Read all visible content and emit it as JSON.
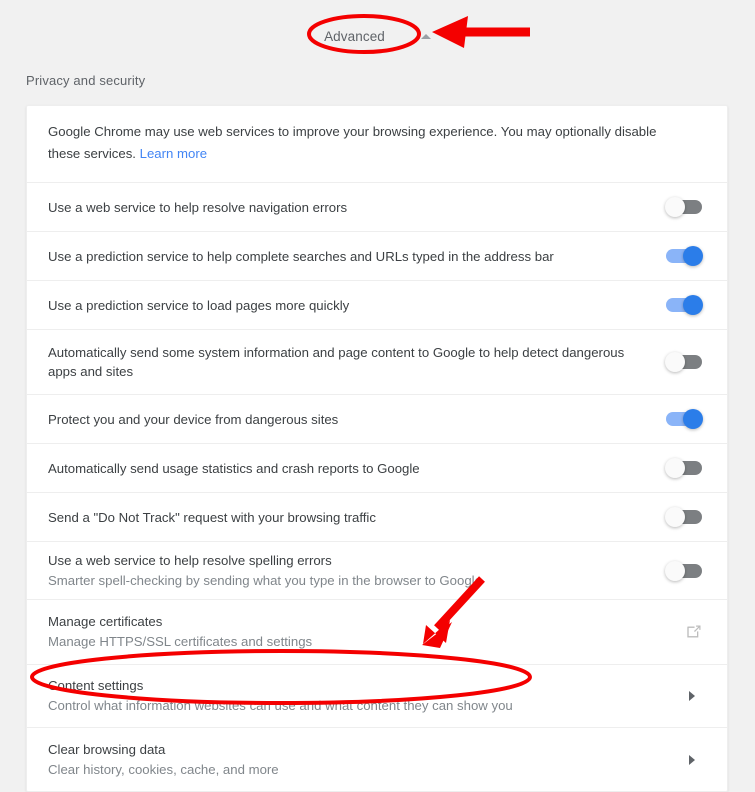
{
  "header": {
    "advanced_label": "Advanced",
    "caret_icon": "caret-up-icon"
  },
  "section": {
    "title": "Privacy and security"
  },
  "colors": {
    "page_background": "#f1f1f1",
    "card_background": "#ffffff",
    "primary_text": "#3c4043",
    "secondary_text": "#80868b",
    "link": "#4285f4",
    "toggle_on_knob": "#2b7de9",
    "toggle_on_track": "#8ab4f8",
    "toggle_off_track": "#7c7f82",
    "annotation_red": "#f40000"
  },
  "intro": {
    "text_before_link": "Google Chrome may use web services to improve your browsing experience. You may optionally disable these services. ",
    "link_label": "Learn more"
  },
  "rows": [
    {
      "label": "Use a web service to help resolve navigation errors",
      "sub": "",
      "control": "toggle",
      "state": "off"
    },
    {
      "label": "Use a prediction service to help complete searches and URLs typed in the address bar",
      "sub": "",
      "control": "toggle",
      "state": "on"
    },
    {
      "label": "Use a prediction service to load pages more quickly",
      "sub": "",
      "control": "toggle",
      "state": "on"
    },
    {
      "label": "Automatically send some system information and page content to Google to help detect dangerous apps and sites",
      "sub": "",
      "control": "toggle",
      "state": "off"
    },
    {
      "label": "Protect you and your device from dangerous sites",
      "sub": "",
      "control": "toggle",
      "state": "on"
    },
    {
      "label": "Automatically send usage statistics and crash reports to Google",
      "sub": "",
      "control": "toggle",
      "state": "off"
    },
    {
      "label": "Send a \"Do Not Track\" request with your browsing traffic",
      "sub": "",
      "control": "toggle",
      "state": "off"
    },
    {
      "label": "Use a web service to help resolve spelling errors",
      "sub": "Smarter spell-checking by sending what you type in the browser to Google",
      "control": "toggle",
      "state": "off"
    },
    {
      "label": "Manage certificates",
      "sub": "Manage HTTPS/SSL certificates and settings",
      "control": "external-link",
      "state": ""
    },
    {
      "label": "Content settings",
      "sub": "Control what information websites can use and what content they can show you",
      "control": "chevron",
      "state": ""
    },
    {
      "label": "Clear browsing data",
      "sub": "Clear history, cookies, cache, and more",
      "control": "chevron",
      "state": ""
    }
  ],
  "annotations": [
    {
      "name": "advanced-highlight-ellipse",
      "shape": "ellipse"
    },
    {
      "name": "advanced-pointer-arrow",
      "shape": "arrow-left"
    },
    {
      "name": "content-settings-highlight-ellipse",
      "shape": "ellipse"
    },
    {
      "name": "content-settings-pointer-arrow",
      "shape": "arrow-down-left"
    }
  ]
}
